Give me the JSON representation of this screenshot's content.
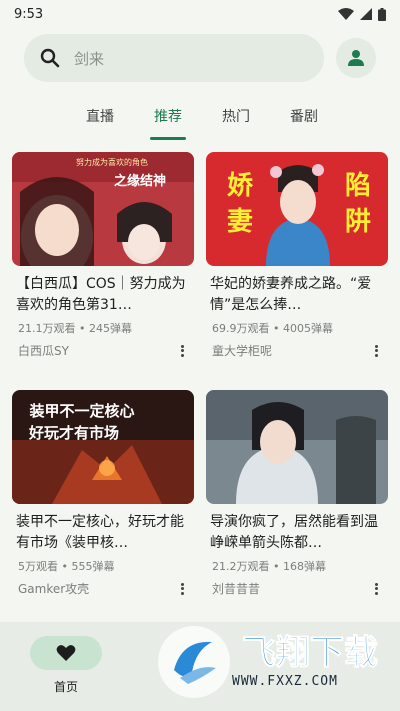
{
  "status_bar": {
    "time": "9:53"
  },
  "search": {
    "placeholder": "剑来"
  },
  "tabs": [
    {
      "label": "直播",
      "active": false
    },
    {
      "label": "推荐",
      "active": true
    },
    {
      "label": "热门",
      "active": false
    },
    {
      "label": "番剧",
      "active": false
    }
  ],
  "cards": [
    {
      "thumb_text": [
        "努力成为喜欢的角色",
        "之缘结神"
      ],
      "title": "【白西瓜】COS｜努力成为喜欢的角色第31…",
      "stats": "21.1万观看 • 245弹幕",
      "author": "白西瓜SY"
    },
    {
      "thumb_text": [
        "娇",
        "陷",
        "妻",
        "阱"
      ],
      "title": "华妃的娇妻养成之路。“爱情”是怎么捧…",
      "stats": "69.9万观看 • 4005弹幕",
      "author": "童大学柜呢"
    },
    {
      "thumb_text": [
        "装甲不一定核心",
        "好玩才有市场"
      ],
      "title": "装甲不一定核心，好玩才能有市场《装甲核…",
      "stats": "5万观看 • 555弹幕",
      "author": "Gamker攻壳"
    },
    {
      "thumb_text": [],
      "title": "导演你疯了，居然能看到温峥嵘单箭头陈都…",
      "stats": "21.2万观看 • 168弹幕",
      "author": "刘昔昔昔"
    }
  ],
  "bottom_nav": {
    "home_label": "首页"
  },
  "watermark": {
    "brand": "飞翔下载",
    "url": "WWW.FXXZ.COM"
  },
  "colors": {
    "accent": "#1e7a4f",
    "background": "#f3f6f1",
    "search_bg": "#e3ebe3",
    "nav_active": "#c8e3cf"
  }
}
